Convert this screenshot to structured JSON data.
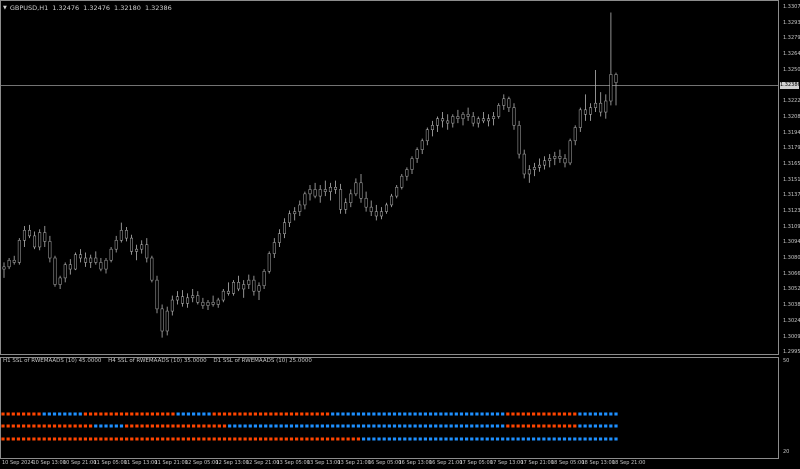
{
  "header": {
    "symbol": "GBPUSD,H1",
    "open": "1.32476",
    "high": "1.32476",
    "low": "1.32180",
    "close": "1.32386"
  },
  "indicator_header": [
    "H1 SSL of RWEMAADS (10) 45.0000",
    "H4 SSL of RWEMAADS (10) 35.0000",
    "D1 SSL of RWEMAADS (10) 25.0000"
  ],
  "current_price": "1.32386",
  "colors": {
    "background": "#000000",
    "candle": "#b4b4b4",
    "bull_tick": "#33cc33",
    "ssl_up": "#1e90ff",
    "ssl_down": "#ff4500",
    "border": "#8c8c8c",
    "price_line": "#9a9a9a"
  },
  "price_axis": {
    "labels": [
      "1.33070",
      "1.32930",
      "1.32790",
      "1.32645",
      "1.32505",
      "1.32220",
      "1.32080",
      "1.31940",
      "1.31795",
      "1.31655",
      "1.31515",
      "1.31370",
      "1.31230",
      "1.31090",
      "1.30945",
      "1.30805",
      "1.30660",
      "1.30520",
      "1.30380",
      "1.30240",
      "1.30095",
      "1.29950"
    ],
    "max": 1.3307,
    "min": 1.2995
  },
  "time_axis": {
    "labels": [
      "10 Sep 2024",
      "10 Sep 13:00",
      "10 Sep 21:00",
      "11 Sep 05:00",
      "11 Sep 13:00",
      "11 Sep 21:00",
      "12 Sep 05:00",
      "12 Sep 13:00",
      "12 Sep 21:00",
      "13 Sep 05:00",
      "13 Sep 13:00",
      "13 Sep 21:00",
      "16 Sep 05:00",
      "16 Sep 13:00",
      "16 Sep 21:00",
      "17 Sep 05:00",
      "17 Sep 13:00",
      "17 Sep 21:00",
      "18 Sep 05:00",
      "18 Sep 13:00",
      "18 Sep 21:00"
    ]
  },
  "subwindow_axis": {
    "top": "50",
    "bottom": "20"
  },
  "candles": [
    [
      1.307,
      1.3076,
      1.3062,
      1.3072
    ],
    [
      1.3072,
      1.308,
      1.307,
      1.3078
    ],
    [
      1.3078,
      1.3082,
      1.3074,
      1.3076
    ],
    [
      1.3076,
      1.3098,
      1.3074,
      1.3096
    ],
    [
      1.3096,
      1.3109,
      1.309,
      1.3105
    ],
    [
      1.3105,
      1.311,
      1.3098,
      1.31
    ],
    [
      1.31,
      1.3104,
      1.3088,
      1.309
    ],
    [
      1.309,
      1.3106,
      1.3087,
      1.3103
    ],
    [
      1.3103,
      1.3109,
      1.309,
      1.3095
    ],
    [
      1.3095,
      1.31,
      1.3076,
      1.308
    ],
    [
      1.308,
      1.3082,
      1.3054,
      1.3056
    ],
    [
      1.3056,
      1.3064,
      1.3052,
      1.3062
    ],
    [
      1.3062,
      1.3076,
      1.3058,
      1.3074
    ],
    [
      1.3074,
      1.3079,
      1.3065,
      1.307
    ],
    [
      1.307,
      1.3085,
      1.3069,
      1.3083
    ],
    [
      1.3083,
      1.3088,
      1.3076,
      1.308
    ],
    [
      1.308,
      1.3085,
      1.3072,
      1.3076
    ],
    [
      1.3076,
      1.3083,
      1.3071,
      1.308
    ],
    [
      1.308,
      1.3086,
      1.3074,
      1.3076
    ],
    [
      1.3076,
      1.308,
      1.3068,
      1.307
    ],
    [
      1.307,
      1.308,
      1.3066,
      1.3078
    ],
    [
      1.3078,
      1.309,
      1.3076,
      1.3088
    ],
    [
      1.3088,
      1.31,
      1.3085,
      1.3096
    ],
    [
      1.3096,
      1.3112,
      1.3094,
      1.3105
    ],
    [
      1.3105,
      1.3108,
      1.3095,
      1.3098
    ],
    [
      1.3098,
      1.3101,
      1.3083,
      1.3086
    ],
    [
      1.3086,
      1.3092,
      1.3078,
      1.3088
    ],
    [
      1.3088,
      1.3096,
      1.3084,
      1.3092
    ],
    [
      1.3092,
      1.3098,
      1.3076,
      1.308
    ],
    [
      1.308,
      1.3082,
      1.3058,
      1.306
    ],
    [
      1.306,
      1.3064,
      1.303,
      1.3034
    ],
    [
      1.3034,
      1.3038,
      1.3008,
      1.3014
    ],
    [
      1.3014,
      1.3036,
      1.301,
      1.3032
    ],
    [
      1.3032,
      1.3046,
      1.3028,
      1.3042
    ],
    [
      1.3042,
      1.305,
      1.3038,
      1.3045
    ],
    [
      1.3045,
      1.3051,
      1.3036,
      1.3039
    ],
    [
      1.3039,
      1.3048,
      1.3035,
      1.3044
    ],
    [
      1.3044,
      1.3052,
      1.304,
      1.3046
    ],
    [
      1.3046,
      1.305,
      1.3038,
      1.304
    ],
    [
      1.304,
      1.3044,
      1.3034,
      1.3037
    ],
    [
      1.3037,
      1.3042,
      1.3033,
      1.304
    ],
    [
      1.304,
      1.3046,
      1.3036,
      1.3038
    ],
    [
      1.3038,
      1.3044,
      1.3035,
      1.3042
    ],
    [
      1.3042,
      1.3052,
      1.304,
      1.305
    ],
    [
      1.305,
      1.3058,
      1.3046,
      1.3048
    ],
    [
      1.3048,
      1.306,
      1.3046,
      1.3058
    ],
    [
      1.3058,
      1.3064,
      1.305,
      1.3052
    ],
    [
      1.3052,
      1.306,
      1.3044,
      1.3056
    ],
    [
      1.3056,
      1.3065,
      1.3052,
      1.306
    ],
    [
      1.306,
      1.3064,
      1.3046,
      1.305
    ],
    [
      1.305,
      1.3058,
      1.3042,
      1.3055
    ],
    [
      1.3055,
      1.307,
      1.3052,
      1.3068
    ],
    [
      1.3068,
      1.3086,
      1.3066,
      1.3084
    ],
    [
      1.3084,
      1.3098,
      1.308,
      1.3094
    ],
    [
      1.3094,
      1.3106,
      1.309,
      1.3102
    ],
    [
      1.3102,
      1.3116,
      1.3098,
      1.3112
    ],
    [
      1.3112,
      1.3123,
      1.3108,
      1.312
    ],
    [
      1.312,
      1.3126,
      1.3114,
      1.3122
    ],
    [
      1.3122,
      1.3132,
      1.3118,
      1.3128
    ],
    [
      1.3128,
      1.314,
      1.3124,
      1.3138
    ],
    [
      1.3138,
      1.3146,
      1.3132,
      1.3142
    ],
    [
      1.3142,
      1.3148,
      1.3134,
      1.3136
    ],
    [
      1.3136,
      1.3146,
      1.313,
      1.3142
    ],
    [
      1.3142,
      1.315,
      1.3136,
      1.314
    ],
    [
      1.314,
      1.3148,
      1.3132,
      1.3144
    ],
    [
      1.3144,
      1.315,
      1.3138,
      1.3142
    ],
    [
      1.3142,
      1.3147,
      1.312,
      1.3124
    ],
    [
      1.3124,
      1.3134,
      1.312,
      1.313
    ],
    [
      1.313,
      1.3142,
      1.3126,
      1.3138
    ],
    [
      1.3138,
      1.3152,
      1.3136,
      1.3148
    ],
    [
      1.3148,
      1.3156,
      1.313,
      1.3134
    ],
    [
      1.3134,
      1.314,
      1.3122,
      1.3126
    ],
    [
      1.3126,
      1.3132,
      1.3118,
      1.3122
    ],
    [
      1.3122,
      1.3128,
      1.3114,
      1.3118
    ],
    [
      1.3118,
      1.3126,
      1.3115,
      1.3122
    ],
    [
      1.3122,
      1.313,
      1.312,
      1.3128
    ],
    [
      1.3128,
      1.3138,
      1.3126,
      1.3136
    ],
    [
      1.3136,
      1.3146,
      1.3134,
      1.3144
    ],
    [
      1.3144,
      1.3156,
      1.3142,
      1.3154
    ],
    [
      1.3154,
      1.3162,
      1.315,
      1.316
    ],
    [
      1.316,
      1.3172,
      1.3156,
      1.317
    ],
    [
      1.317,
      1.318,
      1.3166,
      1.3178
    ],
    [
      1.3178,
      1.3188,
      1.3174,
      1.3186
    ],
    [
      1.3186,
      1.3198,
      1.3182,
      1.3196
    ],
    [
      1.3196,
      1.3204,
      1.319,
      1.32
    ],
    [
      1.32,
      1.3208,
      1.3194,
      1.3206
    ],
    [
      1.3206,
      1.3212,
      1.3198,
      1.3204
    ],
    [
      1.3204,
      1.321,
      1.3196,
      1.3202
    ],
    [
      1.3202,
      1.321,
      1.3198,
      1.3208
    ],
    [
      1.3208,
      1.3214,
      1.3202,
      1.3206
    ],
    [
      1.3206,
      1.3212,
      1.32,
      1.321
    ],
    [
      1.321,
      1.3216,
      1.3204,
      1.3208
    ],
    [
      1.3208,
      1.3212,
      1.3199,
      1.3202
    ],
    [
      1.3202,
      1.3208,
      1.3198,
      1.3206
    ],
    [
      1.3206,
      1.3212,
      1.3202,
      1.3204
    ],
    [
      1.3204,
      1.321,
      1.3199,
      1.3206
    ],
    [
      1.3206,
      1.3212,
      1.32,
      1.3208
    ],
    [
      1.3208,
      1.322,
      1.3206,
      1.3218
    ],
    [
      1.3218,
      1.3228,
      1.3214,
      1.3224
    ],
    [
      1.3224,
      1.3226,
      1.3212,
      1.3216
    ],
    [
      1.3216,
      1.322,
      1.3196,
      1.32
    ],
    [
      1.32,
      1.3204,
      1.317,
      1.3174
    ],
    [
      1.3174,
      1.3178,
      1.3152,
      1.3156
    ],
    [
      1.3156,
      1.3164,
      1.3148,
      1.316
    ],
    [
      1.316,
      1.3166,
      1.3154,
      1.3162
    ],
    [
      1.3162,
      1.317,
      1.3158,
      1.3164
    ],
    [
      1.3164,
      1.3172,
      1.316,
      1.3168
    ],
    [
      1.3168,
      1.3174,
      1.3162,
      1.317
    ],
    [
      1.317,
      1.3176,
      1.3164,
      1.3172
    ],
    [
      1.3172,
      1.3178,
      1.3166,
      1.317
    ],
    [
      1.317,
      1.3174,
      1.3162,
      1.3166
    ],
    [
      1.3166,
      1.3188,
      1.3164,
      1.3186
    ],
    [
      1.3186,
      1.32,
      1.3182,
      1.3198
    ],
    [
      1.3198,
      1.3216,
      1.3194,
      1.3214
    ],
    [
      1.3214,
      1.3228,
      1.3204,
      1.321
    ],
    [
      1.321,
      1.322,
      1.3204,
      1.3216
    ],
    [
      1.3216,
      1.325,
      1.3212,
      1.322
    ],
    [
      1.322,
      1.323,
      1.3208,
      1.3212
    ],
    [
      1.3212,
      1.3228,
      1.3206,
      1.3222
    ],
    [
      1.3222,
      1.3302,
      1.3218,
      1.3246
    ],
    [
      1.3246,
      1.32476,
      1.3218,
      1.32386
    ]
  ],
  "ssl": {
    "h1": [
      0,
      0,
      0,
      0,
      0,
      0,
      0,
      0,
      1,
      1,
      1,
      1,
      1,
      1,
      1,
      1,
      0,
      0,
      0,
      0,
      0,
      0,
      0,
      0,
      0,
      0,
      0,
      0,
      0,
      0,
      0,
      0,
      0,
      0,
      1,
      1,
      1,
      1,
      1,
      1,
      1,
      0,
      0,
      0,
      0,
      0,
      0,
      0,
      0,
      0,
      0,
      0,
      0,
      0,
      0,
      0,
      0,
      0,
      0,
      0,
      0,
      0,
      0,
      0,
      1,
      1,
      1,
      1,
      1,
      1,
      1,
      1,
      1,
      1,
      1,
      1,
      1,
      1,
      1,
      1,
      1,
      1,
      1,
      1,
      1,
      1,
      1,
      1,
      1,
      1,
      1,
      1,
      1,
      1,
      1,
      1,
      1,
      1,
      0,
      0,
      0,
      0,
      0,
      0,
      0,
      0,
      0,
      0,
      0,
      0,
      0,
      0,
      1,
      1,
      1,
      1,
      1,
      1,
      1,
      1
    ],
    "h4": [
      0,
      0,
      0,
      0,
      0,
      0,
      0,
      0,
      0,
      0,
      0,
      0,
      0,
      0,
      0,
      0,
      0,
      0,
      1,
      1,
      1,
      1,
      1,
      1,
      0,
      0,
      0,
      0,
      0,
      0,
      0,
      0,
      0,
      0,
      0,
      0,
      0,
      0,
      0,
      0,
      0,
      0,
      0,
      0,
      1,
      1,
      1,
      1,
      1,
      1,
      1,
      1,
      1,
      1,
      1,
      1,
      1,
      1,
      1,
      1,
      1,
      1,
      1,
      1,
      1,
      1,
      1,
      1,
      1,
      1,
      1,
      1,
      1,
      1,
      1,
      1,
      1,
      1,
      1,
      1,
      1,
      1,
      1,
      1,
      1,
      1,
      1,
      1,
      1,
      1,
      1,
      1,
      1,
      1,
      1,
      1,
      1,
      1,
      0,
      0,
      0,
      0,
      0,
      0,
      0,
      0,
      0,
      0,
      0,
      0,
      0,
      0,
      1,
      1,
      1,
      1,
      1,
      1,
      1,
      1
    ],
    "d1": [
      0,
      0,
      0,
      0,
      0,
      0,
      0,
      0,
      0,
      0,
      0,
      0,
      0,
      0,
      0,
      0,
      0,
      0,
      0,
      0,
      0,
      0,
      0,
      0,
      0,
      0,
      0,
      0,
      0,
      0,
      0,
      0,
      0,
      0,
      0,
      0,
      0,
      0,
      0,
      0,
      0,
      0,
      0,
      0,
      0,
      0,
      0,
      0,
      0,
      0,
      0,
      0,
      0,
      0,
      0,
      0,
      0,
      0,
      0,
      0,
      0,
      0,
      0,
      0,
      0,
      0,
      0,
      0,
      0,
      0,
      1,
      1,
      1,
      1,
      1,
      1,
      1,
      1,
      1,
      1,
      1,
      1,
      1,
      1,
      1,
      1,
      1,
      1,
      1,
      1,
      1,
      1,
      1,
      1,
      1,
      1,
      1,
      1,
      1,
      1,
      1,
      1,
      1,
      1,
      1,
      1,
      1,
      1,
      1,
      1,
      1,
      1,
      1,
      1,
      1,
      1,
      1,
      1,
      1,
      1
    ]
  }
}
